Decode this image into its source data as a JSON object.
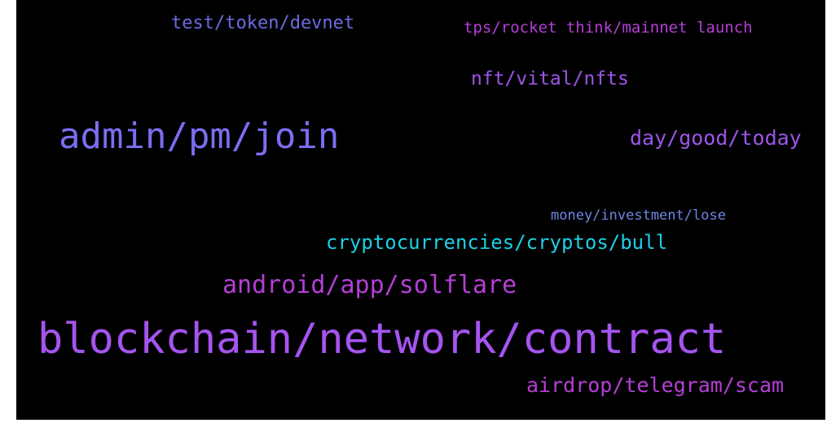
{
  "words": [
    {
      "id": "test",
      "text": "test/token/devnet",
      "color": "#6b6be0"
    },
    {
      "id": "tps",
      "text": "tps/rocket think/mainnet launch",
      "color": "#b43fd6"
    },
    {
      "id": "nft",
      "text": "nft/vital/nfts",
      "color": "#9c55e8"
    },
    {
      "id": "admin",
      "text": "admin/pm/join",
      "color": "#7a6ef0"
    },
    {
      "id": "day",
      "text": "day/good/today",
      "color": "#9c55e8"
    },
    {
      "id": "money",
      "text": "money/investment/lose",
      "color": "#6f86e6"
    },
    {
      "id": "crypto",
      "text": "cryptocurrencies/cryptos/bull",
      "color": "#1ecfe6"
    },
    {
      "id": "android",
      "text": "android/app/solflare",
      "color": "#b43fd6"
    },
    {
      "id": "blockchain",
      "text": "blockchain/network/contract",
      "color": "#a554f0"
    },
    {
      "id": "airdrop",
      "text": "airdrop/telegram/scam",
      "color": "#b43fd6"
    }
  ]
}
